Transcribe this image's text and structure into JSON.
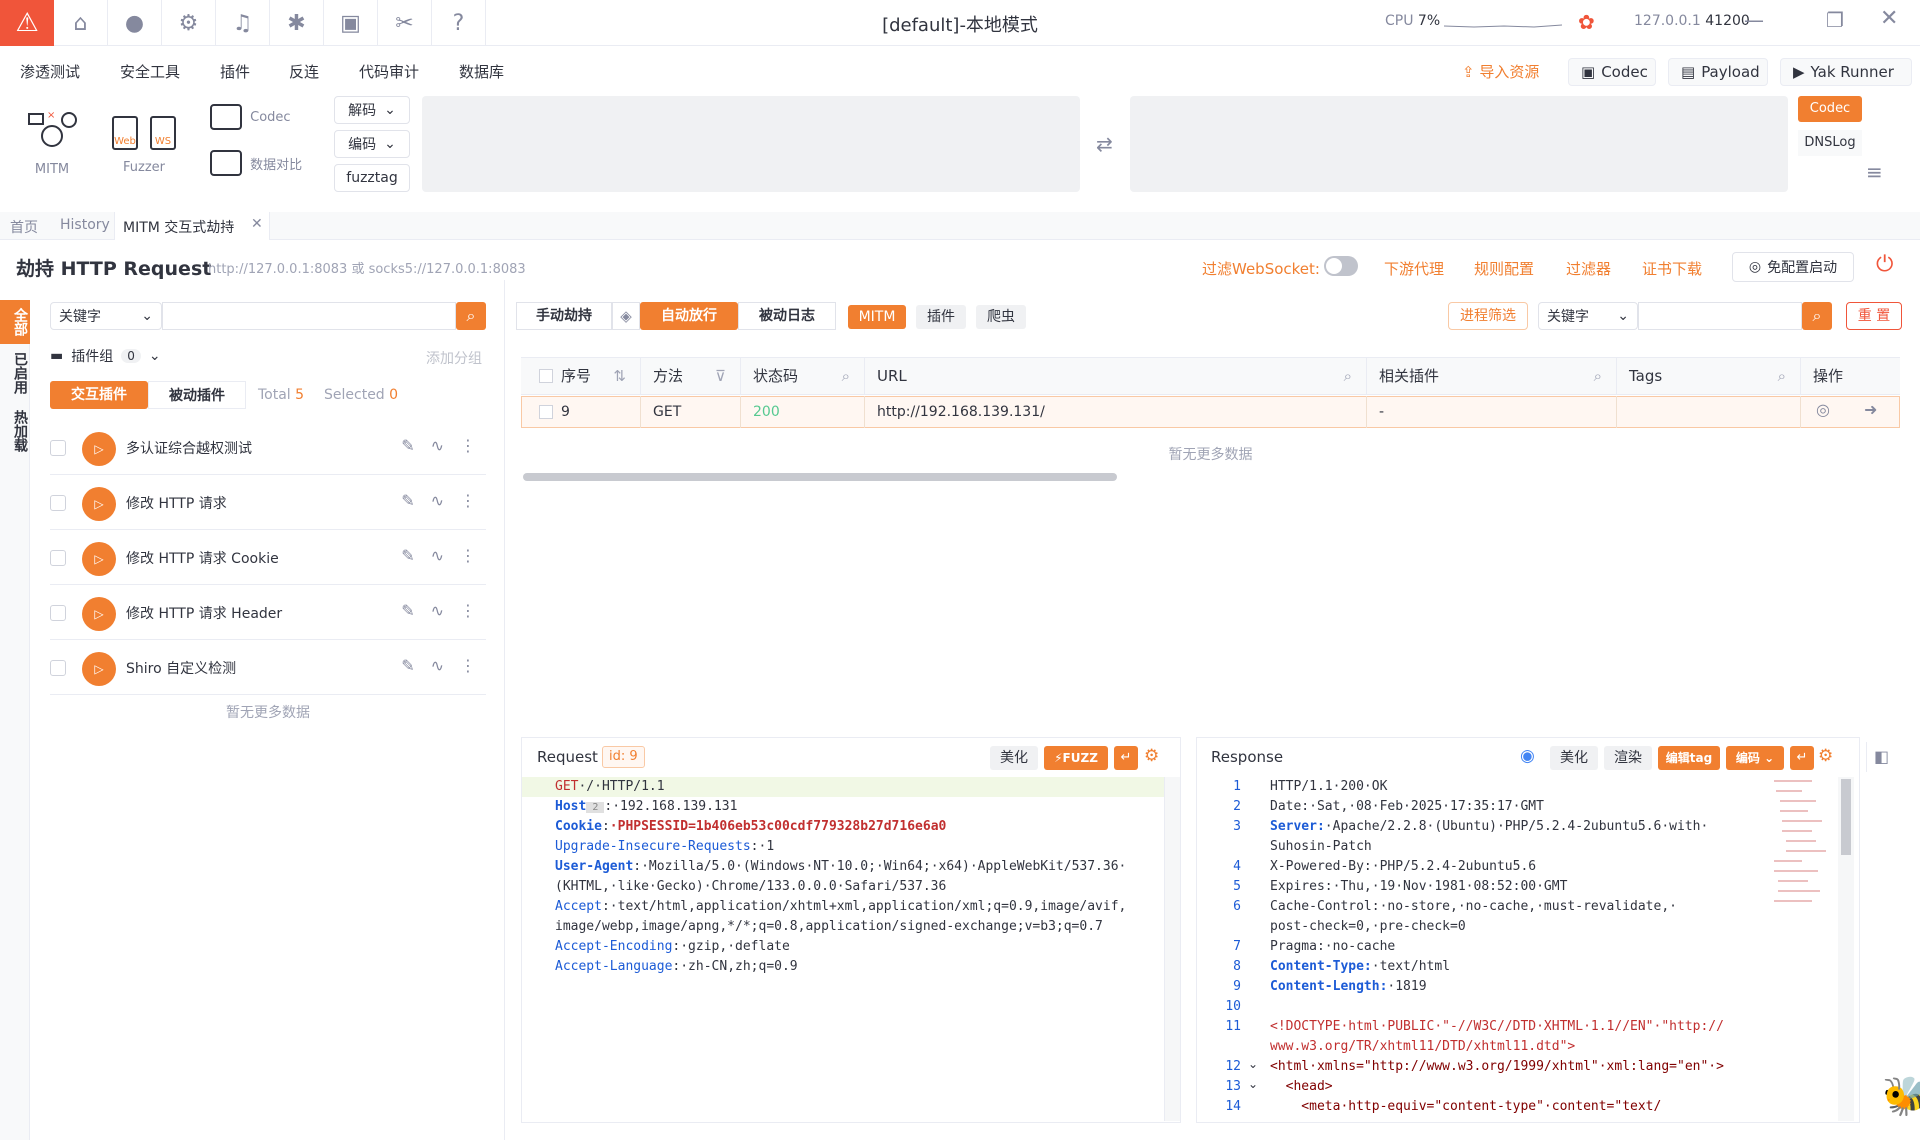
{
  "titlebar": {
    "title": "[default]-本地模式",
    "cpu_label": "CPU",
    "cpu_value": "7%",
    "addr": "127.0.0.1",
    "port": "41200"
  },
  "menu": {
    "items": [
      "渗透测试",
      "安全工具",
      "插件",
      "反连",
      "代码审计",
      "数据库"
    ],
    "import_label": "导入资源",
    "codec": "Codec",
    "payload": "Payload",
    "yak_runner": "Yak Runner"
  },
  "tools": {
    "mitm": "MITM",
    "fuzzer": "Fuzzer",
    "web": "Web",
    "ws": "WS",
    "codec": "Codec",
    "compare": "数据对比",
    "decode": "解码",
    "encode": "编码",
    "fuzztag": "fuzztag",
    "codec_side": "Codec",
    "dnslog": "DNSLog"
  },
  "tabs": [
    "首页",
    "History",
    "MITM 交互式劫持"
  ],
  "header": {
    "title": "劫持 HTTP Request",
    "proxy": "http://127.0.0.1:8083 或 socks5://127.0.0.1:8083",
    "filter_ws": "过滤WebSocket:",
    "downstream": "下游代理",
    "rules": "规则配置",
    "filters": "过滤器",
    "cert": "证书下载",
    "no_config": "免配置启动"
  },
  "sidebar": [
    "全部",
    "已启用",
    "热加载"
  ],
  "left": {
    "keyword": "关键字",
    "plugin_group": "插件组",
    "group_count": "0",
    "add_group": "添加分组",
    "tab_interactive": "交互插件",
    "tab_passive": "被动插件",
    "total_label": "Total",
    "total": "5",
    "selected_label": "Selected",
    "selected": "0",
    "plugins": [
      "多认证综合越权测试",
      "修改 HTTP 请求",
      "修改 HTTP 请求 Cookie",
      "修改 HTTP 请求 Header",
      "Shiro 自定义检测"
    ],
    "no_more": "暂无更多数据"
  },
  "toolbar": {
    "manual": "手动劫持",
    "auto": "自动放行",
    "passive_log": "被动日志",
    "mitm": "MITM",
    "plugins": "插件",
    "crawler": "爬虫",
    "process_filter": "进程筛选",
    "keyword": "关键字",
    "reset": "重 置"
  },
  "table": {
    "headers": [
      "序号",
      "方法",
      "状态码",
      "URL",
      "相关插件",
      "Tags",
      "操作"
    ],
    "row": {
      "id": "9",
      "method": "GET",
      "status": "200",
      "url": "http://192.168.139.131/",
      "plugin": "-"
    },
    "no_more": "暂无更多数据"
  },
  "request": {
    "title": "Request",
    "id_label": "id: 9",
    "beautify": "美化",
    "fuzz": "FUZZ",
    "lines": [
      [
        "GET",
        "·/·HTTP/1.1"
      ],
      [
        "Host",
        "·192.168.139.131"
      ],
      [
        "Cookie",
        "·PHPSESSID=1b406eb53c00cdf779328b27d716e6a0"
      ],
      [
        "Upgrade-Insecure-Requests",
        ":·1"
      ],
      [
        "User-Agent",
        ":·Mozilla/5.0·(Windows·NT·10.0;·Win64;·x64)·AppleWebKit/537.36·"
      ],
      [
        "",
        "(KHTML,·like·Gecko)·Chrome/133.0.0.0·Safari/537.36"
      ],
      [
        "Accept",
        ":·text/html,application/xhtml+xml,application/xml;q=0.9,image/avif,"
      ],
      [
        "",
        "image/webp,image/apng,*/*;q=0.8,application/signed-exchange;v=b3;q=0.7"
      ],
      [
        "Accept-Encoding",
        ":·gzip,·deflate"
      ],
      [
        "Accept-Language",
        ":·zh-CN,zh;q=0.9"
      ]
    ]
  },
  "response": {
    "title": "Response",
    "beautify": "美化",
    "render": "渲染",
    "edit_tag": "编辑tag",
    "encode": "编码",
    "lines": [
      [
        "1",
        "",
        "HTTP/1.1·200·OK"
      ],
      [
        "2",
        "",
        "Date:·Sat,·08·Feb·2025·17:35:17·GMT"
      ],
      [
        "3",
        "Server:",
        "·Apache/2.2.8·(Ubuntu)·PHP/5.2.4-2ubuntu5.6·with·"
      ],
      [
        "",
        "",
        "Suhosin-Patch"
      ],
      [
        "4",
        "",
        "X-Powered-By:·PHP/5.2.4-2ubuntu5.6"
      ],
      [
        "5",
        "",
        "Expires:·Thu,·19·Nov·1981·08:52:00·GMT"
      ],
      [
        "6",
        "",
        "Cache-Control:·no-store,·no-cache,·must-revalidate,·"
      ],
      [
        "",
        "",
        "post-check=0,·pre-check=0"
      ],
      [
        "7",
        "",
        "Pragma:·no-cache"
      ],
      [
        "8",
        "Content-Type:",
        "·text/html"
      ],
      [
        "9",
        "Content-Length:",
        "·1819"
      ],
      [
        "10",
        "",
        ""
      ],
      [
        "11",
        "",
        "<!DOCTYPE·html·PUBLIC·\"-//W3C//DTD·XHTML·1.1//EN\"·\"http://"
      ],
      [
        "",
        "",
        "www.w3.org/TR/xhtml11/DTD/xhtml11.dtd\">"
      ],
      [
        "12",
        "",
        "<html·xmlns=\"http://www.w3.org/1999/xhtml\"·xml:lang=\"en\"·>"
      ],
      [
        "13",
        "",
        "  <head>"
      ],
      [
        "14",
        "",
        "    <meta·http-equiv=\"content-type\"·content=\"text/"
      ]
    ]
  },
  "colors": {
    "accent": "#f17f30",
    "danger": "#f0553a"
  }
}
